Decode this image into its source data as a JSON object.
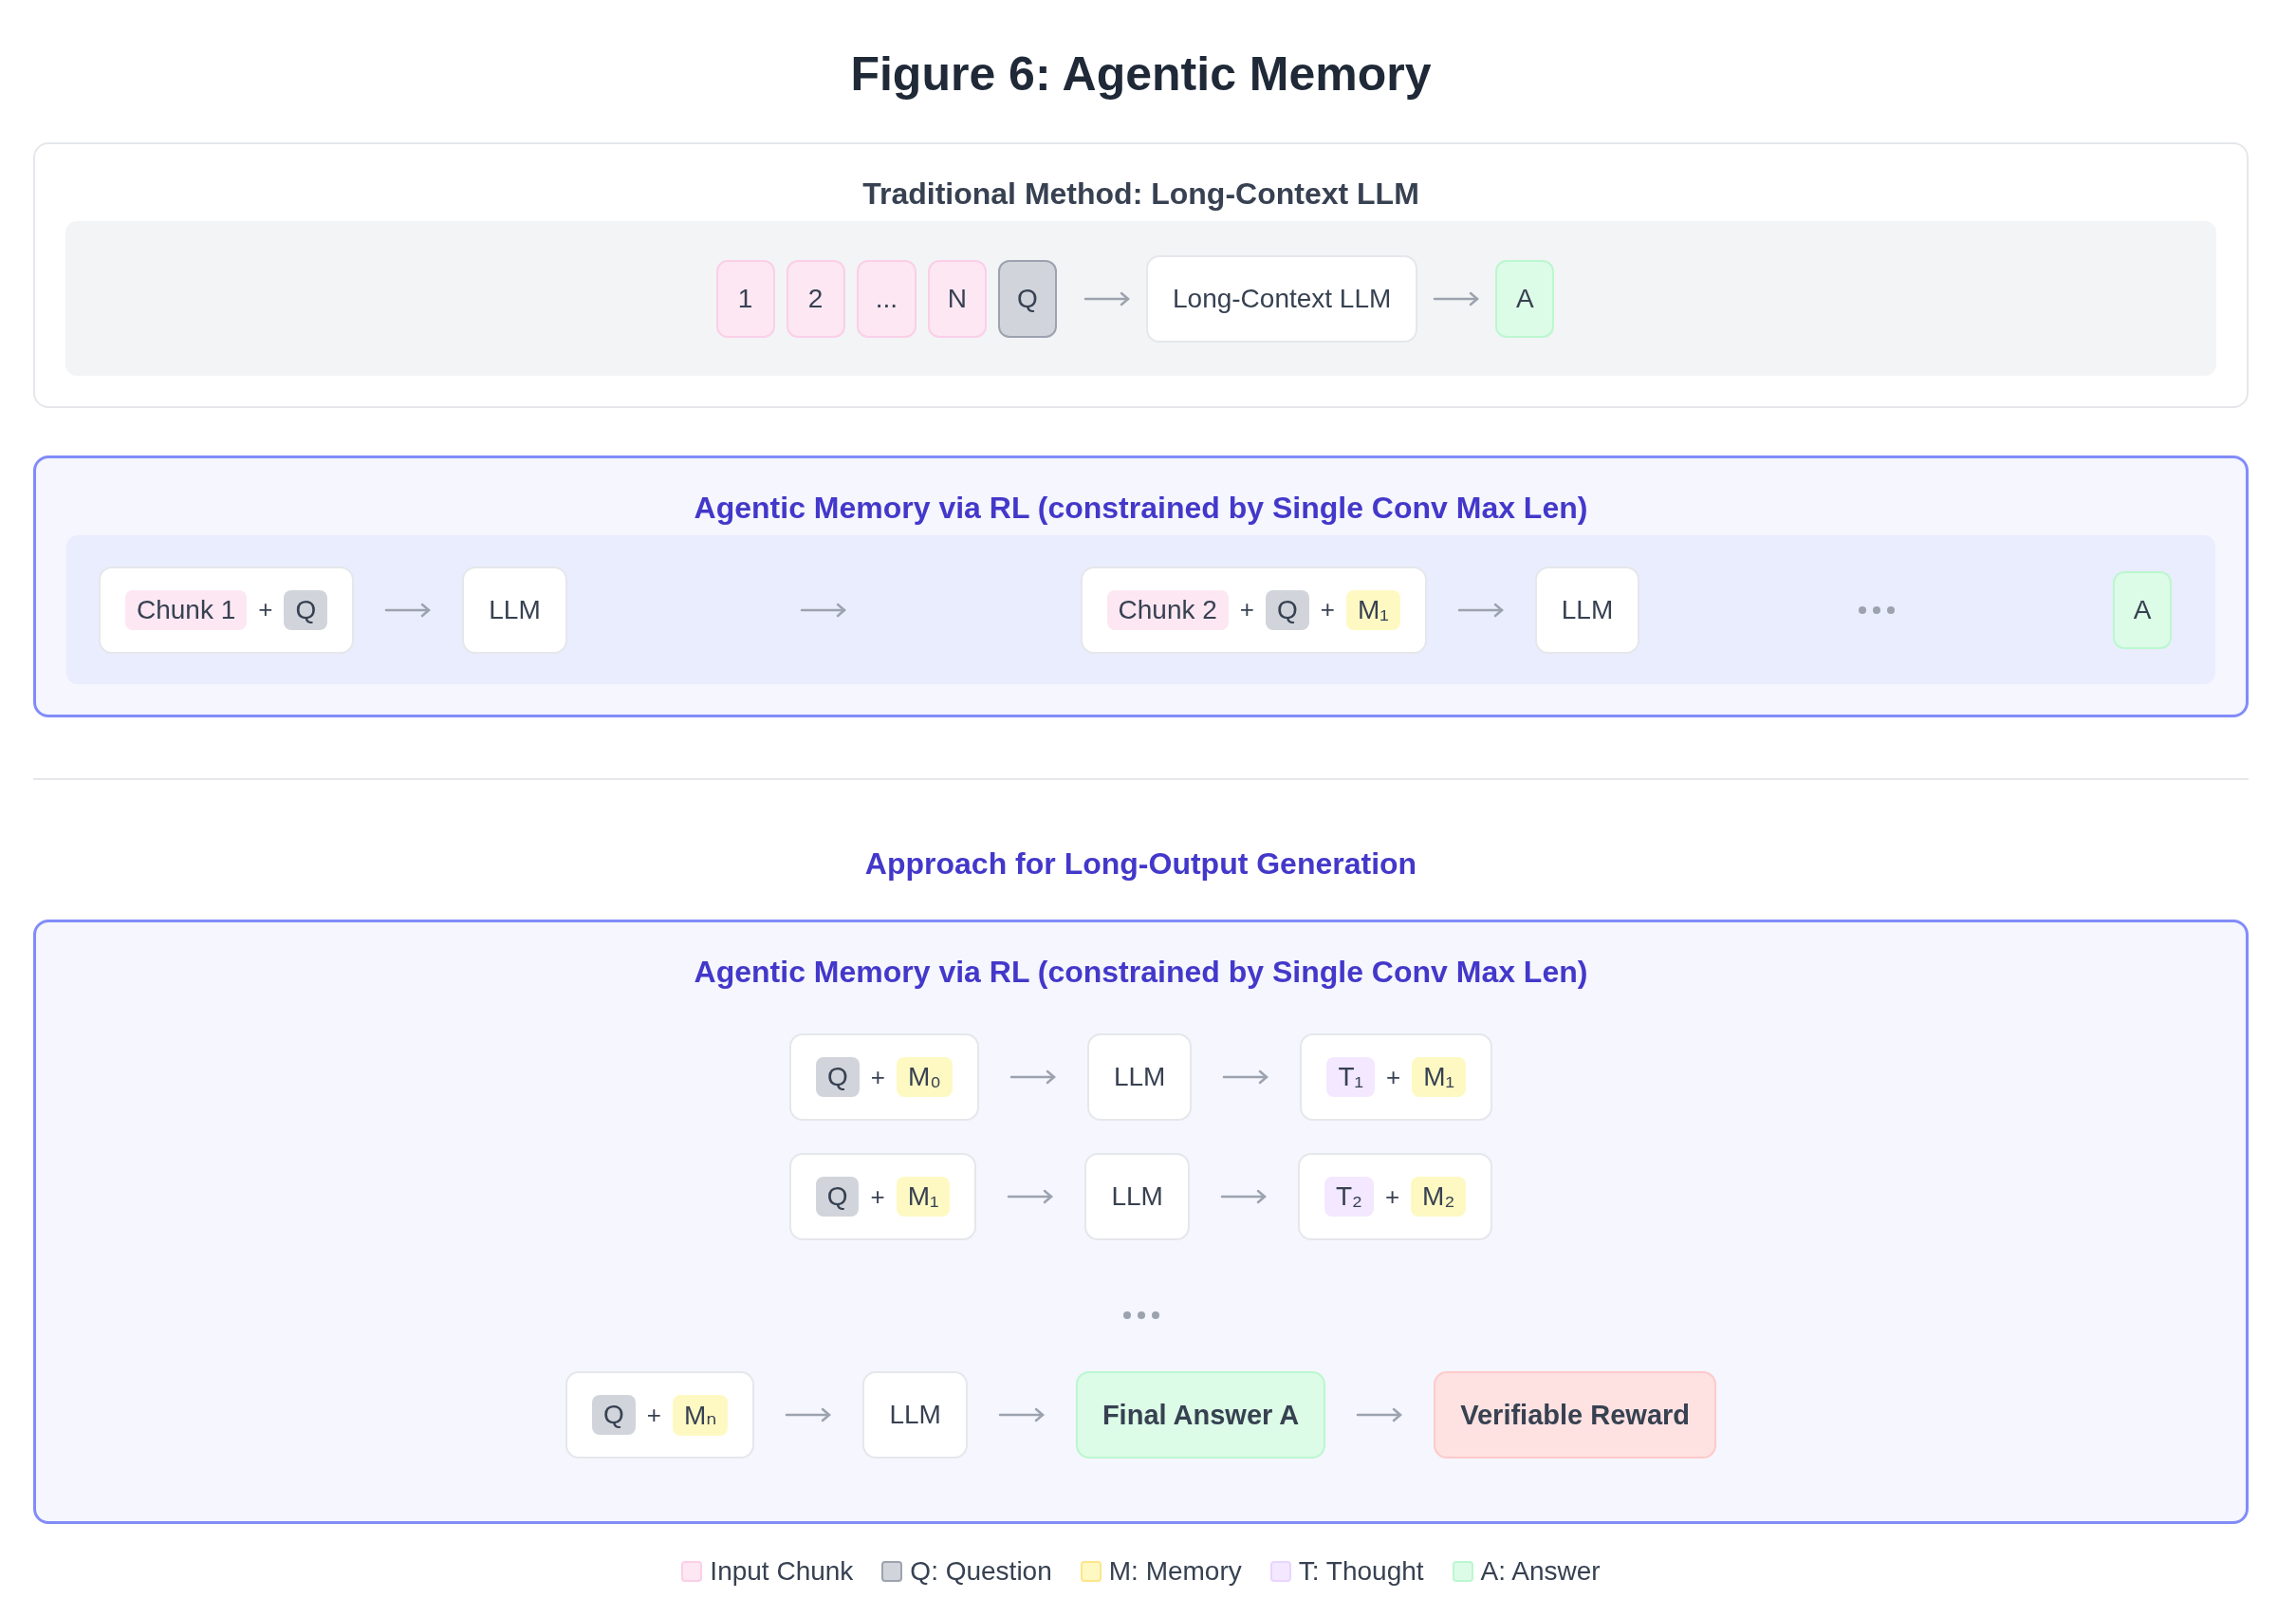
{
  "title": "Figure 6: Agentic Memory",
  "traditional": {
    "title": "Traditional Method: Long-Context LLM",
    "groups": [
      {
        "items": [
          {
            "kind": "chunk",
            "text": "1"
          },
          {
            "kind": "chunk",
            "text": "2"
          },
          {
            "kind": "chunk",
            "text": "..."
          },
          {
            "kind": "chunk",
            "text": "N"
          },
          {
            "kind": "question",
            "text": "Q"
          },
          {
            "kind": "arrow"
          },
          {
            "kind": "box",
            "parts": [
              {
                "text": "Long-Context LLM",
                "kind": "text"
              }
            ]
          },
          {
            "kind": "arrow"
          },
          {
            "kind": "answer",
            "text": "A"
          }
        ]
      }
    ]
  },
  "agentic": {
    "title": "Agentic Memory via RL (constrained by Single Conv Max Len)",
    "groups": [
      {
        "items": [
          {
            "kind": "box",
            "parts": [
              {
                "text": "Chunk 1",
                "kind": "chunk"
              },
              {
                "text": "+",
                "kind": "text"
              },
              {
                "text": "Q",
                "kind": "question"
              }
            ]
          },
          {
            "kind": "arrow"
          },
          {
            "kind": "box",
            "parts": [
              {
                "text": "LLM",
                "kind": "text"
              }
            ]
          }
        ]
      },
      {
        "items": [
          {
            "kind": "arrow"
          }
        ]
      },
      {
        "items": [
          {
            "kind": "box",
            "parts": [
              {
                "text": "Chunk 2",
                "kind": "chunk"
              },
              {
                "text": "+",
                "kind": "text"
              },
              {
                "text": "Q",
                "kind": "question"
              },
              {
                "text": "+",
                "kind": "text"
              },
              {
                "text": "M₁",
                "kind": "memory"
              }
            ]
          },
          {
            "kind": "arrow"
          },
          {
            "kind": "box",
            "parts": [
              {
                "text": "LLM",
                "kind": "text"
              }
            ]
          }
        ]
      },
      {
        "items": [
          {
            "kind": "dots"
          }
        ]
      },
      {
        "items": [
          {
            "kind": "answer",
            "text": "A"
          }
        ]
      }
    ]
  },
  "long_output": {
    "heading": "Approach for Long-Output Generation",
    "title": "Agentic Memory via RL (constrained by Single Conv Max Len)",
    "rows": [
      {
        "items": [
          {
            "kind": "box",
            "parts": [
              {
                "text": "Q",
                "kind": "question"
              },
              {
                "text": "+",
                "kind": "text"
              },
              {
                "text": "M₀",
                "kind": "memory"
              }
            ]
          },
          {
            "kind": "arrow"
          },
          {
            "kind": "box",
            "parts": [
              {
                "text": "LLM",
                "kind": "text"
              }
            ]
          },
          {
            "kind": "arrow"
          },
          {
            "kind": "box",
            "parts": [
              {
                "text": "T₁",
                "kind": "thought"
              },
              {
                "text": "+",
                "kind": "text"
              },
              {
                "text": "M₁",
                "kind": "memory"
              }
            ]
          }
        ]
      },
      {
        "items": [
          {
            "kind": "box",
            "parts": [
              {
                "text": "Q",
                "kind": "question"
              },
              {
                "text": "+",
                "kind": "text"
              },
              {
                "text": "M₁",
                "kind": "memory"
              }
            ]
          },
          {
            "kind": "arrow"
          },
          {
            "kind": "box",
            "parts": [
              {
                "text": "LLM",
                "kind": "text"
              }
            ]
          },
          {
            "kind": "arrow"
          },
          {
            "kind": "box",
            "parts": [
              {
                "text": "T₂",
                "kind": "thought"
              },
              {
                "text": "+",
                "kind": "text"
              },
              {
                "text": "M₂",
                "kind": "memory"
              }
            ]
          }
        ]
      },
      {
        "items": [
          {
            "kind": "dots"
          }
        ]
      },
      {
        "items": [
          {
            "kind": "box",
            "parts": [
              {
                "text": "Q",
                "kind": "question"
              },
              {
                "text": "+",
                "kind": "text"
              },
              {
                "text": "Mₙ",
                "kind": "memory"
              }
            ]
          },
          {
            "kind": "arrow"
          },
          {
            "kind": "box",
            "parts": [
              {
                "text": "LLM",
                "kind": "text"
              }
            ]
          },
          {
            "kind": "arrow"
          },
          {
            "kind": "answer_result",
            "text": "Final Answer A"
          },
          {
            "kind": "arrow"
          },
          {
            "kind": "reward_result",
            "text": "Verifiable Reward"
          }
        ]
      }
    ]
  },
  "legend": [
    {
      "label": "Input Chunk",
      "kind": "chunk"
    },
    {
      "label": "Q: Question",
      "kind": "question"
    },
    {
      "label": "M: Memory",
      "kind": "memory"
    },
    {
      "label": "T: Thought",
      "kind": "thought"
    },
    {
      "label": "A: Answer",
      "kind": "answer"
    }
  ]
}
